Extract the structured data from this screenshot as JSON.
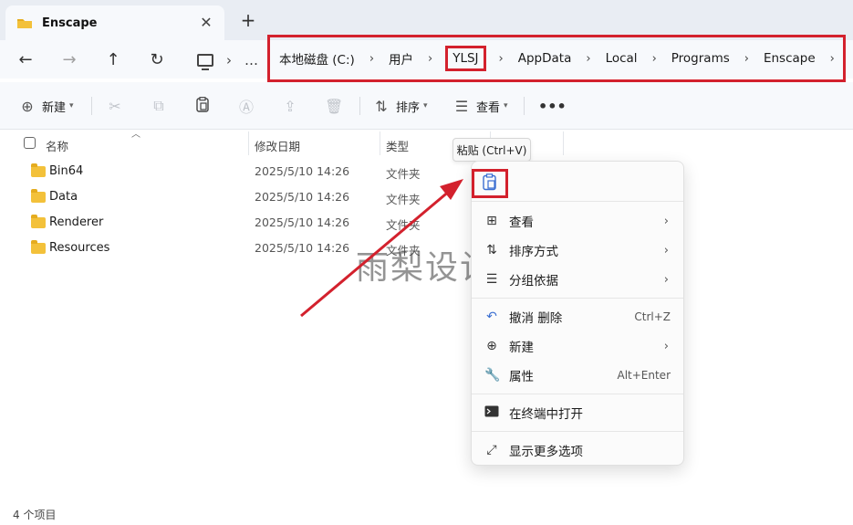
{
  "window": {
    "tab_title": "Enscape",
    "tab_close": "✕",
    "new_tab": "+"
  },
  "nav": {
    "back": "←",
    "forward": "→",
    "up": "↑",
    "refresh": "↻",
    "overflow": "…"
  },
  "breadcrumb": [
    "本地磁盘 (C:)",
    "用户",
    "YLSJ",
    "AppData",
    "Local",
    "Programs",
    "Enscape"
  ],
  "breadcrumb_highlight_index": 2,
  "toolbar": {
    "new_label": "新建",
    "sort_label": "排序",
    "view_label": "查看",
    "more": "•••"
  },
  "columns": {
    "name": "名称",
    "date": "修改日期",
    "type": "类型"
  },
  "files": [
    {
      "name": "Bin64",
      "date": "2025/5/10 14:26",
      "type": "文件夹"
    },
    {
      "name": "Data",
      "date": "2025/5/10 14:26",
      "type": "文件夹"
    },
    {
      "name": "Renderer",
      "date": "2025/5/10 14:26",
      "type": "文件夹"
    },
    {
      "name": "Resources",
      "date": "2025/5/10 14:26",
      "type": "文件夹"
    }
  ],
  "status": "4 个项目",
  "tooltip": "粘贴 (Ctrl+V)",
  "menu": {
    "view": "查看",
    "sort": "排序方式",
    "group": "分组依据",
    "undo": "撤消 删除",
    "undo_key": "Ctrl+Z",
    "new": "新建",
    "properties": "属性",
    "properties_key": "Alt+Enter",
    "terminal": "在终端中打开",
    "more_options": "显示更多选项"
  },
  "watermark": "雨梨设计",
  "colors": {
    "highlight_red": "#d3212d",
    "folder_yellow": "#f3c13a",
    "accent_blue": "#3b6fd1"
  }
}
